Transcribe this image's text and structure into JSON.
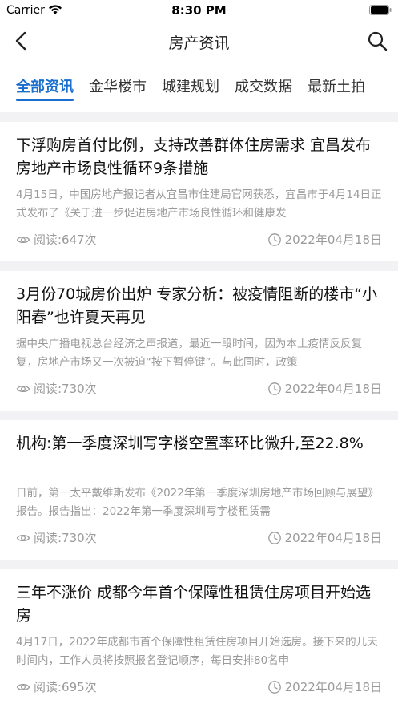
{
  "status_bar": {
    "carrier": "Carrier",
    "time": "8:30 PM"
  },
  "nav": {
    "title": "房产资讯"
  },
  "tabs": [
    {
      "label": "全部资讯",
      "active": true
    },
    {
      "label": "金华楼市",
      "active": false
    },
    {
      "label": "城建规划",
      "active": false
    },
    {
      "label": "成交数据",
      "active": false
    },
    {
      "label": "最新土拍",
      "active": false
    }
  ],
  "articles": [
    {
      "title": "下浮购房首付比例，支持改善群体住房需求 宜昌发布房地产市场良性循环9条措施",
      "summary": "4月15日，中国房地产报记者从宜昌市住建局官网获悉，宜昌市于4月14日正式发布了《关于进一步促进房地产市场良性循环和健康发",
      "views": "阅读:647次",
      "date": "2022年04月18日"
    },
    {
      "title": "3月份70城房价出炉 专家分析：被疫情阻断的楼市“小阳春”也许夏天再见",
      "summary": "据中央广播电视总台经济之声报道，最近一段时间，因为本土疫情反反复复，房地产市场又一次被迫“按下暂停键”。与此同时，政策",
      "views": "阅读:730次",
      "date": "2022年04月18日"
    },
    {
      "title": "机构:第一季度深圳写字楼空置率环比微升,至22.8%",
      "summary": "日前，第一太平戴维斯发布《2022年第一季度深圳房地产市场回顾与展望》报告。报告指出：2022年第一季度深圳写字楼租赁需",
      "views": "阅读:730次",
      "date": "2022年04月18日"
    },
    {
      "title": "三年不涨价 成都今年首个保障性租赁住房项目开始选房",
      "summary": "4月17日，2022年成都市首个保障性租赁住房项目开始选房。接下来的几天时间内，工作人员将按照报名登记顺序，每日安排80名申",
      "views": "阅读:695次",
      "date": "2022年04月18日"
    }
  ]
}
